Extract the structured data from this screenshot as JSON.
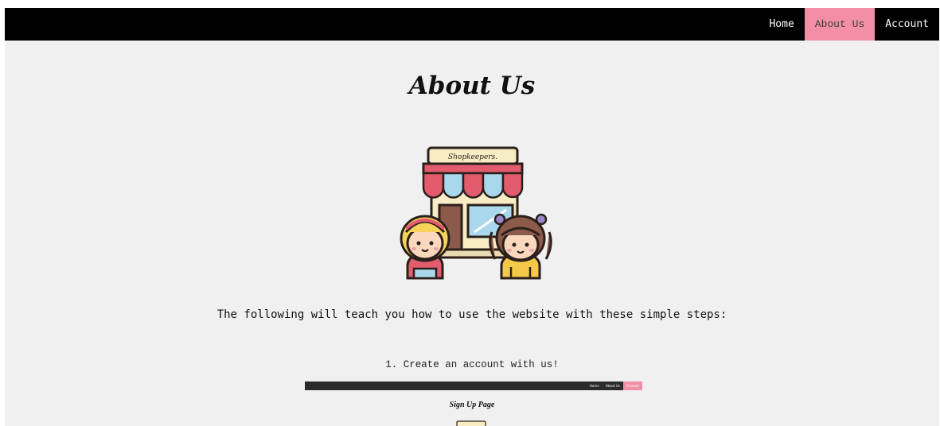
{
  "nav": {
    "links": [
      {
        "label": "Home"
      },
      {
        "label": "About Us"
      },
      {
        "label": "Account"
      }
    ],
    "active_index": 1,
    "background_color": "#000000",
    "active_color": "#f28fa6"
  },
  "page": {
    "title": "About Us",
    "background_color": "#f0f0f0"
  },
  "hero": {
    "sign_text": "Shopkeepers.",
    "icon": "shop-with-two-kids-illustration"
  },
  "intro": {
    "text": "The following will teach you how to use the website with these simple steps:"
  },
  "steps": [
    {
      "number": "1.",
      "text": "1. Create an account with us!",
      "screenshot": {
        "nav_links": [
          "Home",
          "About Us",
          "Account"
        ],
        "highlight": "Account",
        "caption": "Sign Up Page"
      }
    }
  ]
}
